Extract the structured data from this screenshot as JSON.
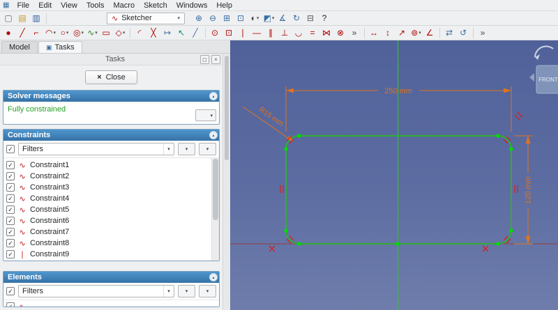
{
  "app": {
    "icon_glyph": "▦"
  },
  "menubar": {
    "items": [
      {
        "name": "menu-file",
        "label": "File"
      },
      {
        "name": "menu-edit",
        "label": "Edit"
      },
      {
        "name": "menu-view",
        "label": "View"
      },
      {
        "name": "menu-tools",
        "label": "Tools"
      },
      {
        "name": "menu-macro",
        "label": "Macro"
      },
      {
        "name": "menu-sketch",
        "label": "Sketch"
      },
      {
        "name": "menu-windows",
        "label": "Windows"
      },
      {
        "name": "menu-help",
        "label": "Help"
      }
    ]
  },
  "toolbar_file": {
    "icons": [
      {
        "name": "new-document-icon",
        "glyph": "▢",
        "color": "#6a6c6e",
        "cls": "tb-icon",
        "caret": "",
        "inter": "true"
      },
      {
        "name": "open-document-icon",
        "glyph": "▤",
        "color": "#c9972f",
        "cls": "tb-icon",
        "caret": "",
        "inter": "true"
      },
      {
        "name": "save-icon",
        "glyph": "▥",
        "color": "#2e5fa3",
        "cls": "tb-icon",
        "caret": "",
        "inter": "true"
      },
      {
        "name": "separator",
        "glyph": "",
        "color": "",
        "cls": "tb-sep",
        "caret": "",
        "inter": "false"
      }
    ]
  },
  "workbench": {
    "selected": "Sketcher",
    "icon": "∿",
    "caret": "▾"
  },
  "toolbar_view": {
    "icons": [
      {
        "name": "zoom-in-icon",
        "glyph": "⊕",
        "color": "#3a6ea5",
        "cls": "tb-icon",
        "caret": "",
        "inter": "true"
      },
      {
        "name": "zoom-out-icon",
        "glyph": "⊖",
        "color": "#3a6ea5",
        "cls": "tb-icon",
        "caret": "",
        "inter": "true"
      },
      {
        "name": "fit-all-icon",
        "glyph": "⊞",
        "color": "#3a6ea5",
        "cls": "tb-icon",
        "caret": "",
        "inter": "true"
      },
      {
        "name": "box-zoom-icon",
        "glyph": "⊡",
        "color": "#3a6ea5",
        "cls": "tb-icon",
        "caret": "",
        "inter": "true"
      },
      {
        "name": "draw-style-icon",
        "glyph": "◐",
        "color": "#3f4144",
        "cls": "tb-icon",
        "caret": "▾",
        "inter": "true"
      },
      {
        "name": "axonometric-view-icon",
        "glyph": "◩",
        "color": "#3a6ea5",
        "cls": "tb-icon",
        "caret": "▾",
        "inter": "true"
      },
      {
        "name": "measure-icon",
        "glyph": "∡",
        "color": "#3a6ea5",
        "cls": "tb-icon",
        "caret": "",
        "inter": "true"
      },
      {
        "name": "refresh-view-icon",
        "glyph": "↻",
        "color": "#3a6ea5",
        "cls": "tb-icon",
        "caret": "",
        "inter": "true"
      },
      {
        "name": "dock-view-icon",
        "glyph": "⊟",
        "color": "#55585b",
        "cls": "tb-icon",
        "caret": "",
        "inter": "true"
      },
      {
        "name": "help-whatsthis-icon",
        "glyph": "?",
        "color": "#232629",
        "cls": "tb-icon",
        "caret": "",
        "inter": "true"
      }
    ]
  },
  "toolbar_sketch": {
    "icons": [
      {
        "name": "create-point-icon",
        "glyph": "●",
        "color": "#b00000",
        "cls": "tb-icon",
        "caret": "",
        "inter": "true"
      },
      {
        "name": "create-line-icon",
        "glyph": "╱",
        "color": "#b00000",
        "cls": "tb-icon",
        "caret": "",
        "inter": "true"
      },
      {
        "name": "create-polyline-icon",
        "glyph": "⌐",
        "color": "#b00000",
        "cls": "tb-icon",
        "caret": "",
        "inter": "true"
      },
      {
        "name": "create-arc-icon",
        "glyph": "◠",
        "color": "#b00000",
        "cls": "tb-icon",
        "caret": "▾",
        "inter": "true"
      },
      {
        "name": "create-circle-icon",
        "glyph": "○",
        "color": "#b00000",
        "cls": "tb-icon",
        "caret": "▾",
        "inter": "true"
      },
      {
        "name": "create-conic-icon",
        "glyph": "◎",
        "color": "#b00000",
        "cls": "tb-icon",
        "caret": "▾",
        "inter": "true"
      },
      {
        "name": "create-bspline-icon",
        "glyph": "∿",
        "color": "#1e8a1e",
        "cls": "tb-icon",
        "caret": "▾",
        "inter": "true"
      },
      {
        "name": "create-rectangle-icon",
        "glyph": "▭",
        "color": "#b00000",
        "cls": "tb-icon",
        "caret": "",
        "inter": "true"
      },
      {
        "name": "create-polygon-icon",
        "glyph": "◇",
        "color": "#b00000",
        "cls": "tb-icon",
        "caret": "▾",
        "inter": "true"
      },
      {
        "name": "separator",
        "glyph": "",
        "color": "",
        "cls": "tb-sep",
        "caret": "",
        "inter": "false"
      },
      {
        "name": "create-fillet-icon",
        "glyph": "◜",
        "color": "#b00000",
        "cls": "tb-icon",
        "caret": "",
        "inter": "true"
      },
      {
        "name": "trim-edge-icon",
        "glyph": "╳",
        "color": "#b00000",
        "cls": "tb-icon",
        "caret": "",
        "inter": "true"
      },
      {
        "name": "extend-edge-icon",
        "glyph": "↦",
        "color": "#3a6ea5",
        "cls": "tb-icon",
        "caret": "",
        "inter": "true"
      },
      {
        "name": "external-geometry-icon",
        "glyph": "↖",
        "color": "#0a8a8a",
        "cls": "tb-icon",
        "caret": "",
        "inter": "true"
      },
      {
        "name": "toggle-construction-icon",
        "glyph": "╱",
        "color": "#3a6ea5",
        "cls": "tb-icon",
        "caret": "",
        "inter": "true"
      },
      {
        "name": "separator",
        "glyph": "",
        "color": "",
        "cls": "tb-sep",
        "caret": "",
        "inter": "false"
      },
      {
        "name": "constrain-coincident-icon",
        "glyph": "⊙",
        "color": "#b00000",
        "cls": "tb-icon",
        "caret": "",
        "inter": "true"
      },
      {
        "name": "constrain-point-on-object-icon",
        "glyph": "⊡",
        "color": "#b00000",
        "cls": "tb-icon",
        "caret": "",
        "inter": "true"
      },
      {
        "name": "constrain-vertical-icon",
        "glyph": "∣",
        "color": "#b00000",
        "cls": "tb-icon",
        "caret": "",
        "inter": "true"
      },
      {
        "name": "constrain-horizontal-icon",
        "glyph": "―",
        "color": "#b00000",
        "cls": "tb-icon",
        "caret": "",
        "inter": "true"
      },
      {
        "name": "constrain-parallel-icon",
        "glyph": "∥",
        "color": "#b00000",
        "cls": "tb-icon",
        "caret": "",
        "inter": "true"
      },
      {
        "name": "constrain-perpendicular-icon",
        "glyph": "⊥",
        "color": "#b00000",
        "cls": "tb-icon",
        "caret": "",
        "inter": "true"
      },
      {
        "name": "constrain-tangent-icon",
        "glyph": "◡",
        "color": "#b00000",
        "cls": "tb-icon",
        "caret": "",
        "inter": "true"
      },
      {
        "name": "constrain-equal-icon",
        "glyph": "=",
        "color": "#b00000",
        "cls": "tb-icon",
        "caret": "",
        "inter": "true"
      },
      {
        "name": "constrain-symmetric-icon",
        "glyph": "⋈",
        "color": "#b00000",
        "cls": "tb-icon",
        "caret": "",
        "inter": "true"
      },
      {
        "name": "constrain-block-icon",
        "glyph": "⊗",
        "color": "#b00000",
        "cls": "tb-icon",
        "caret": "",
        "inter": "true"
      },
      {
        "name": "constraints-overflow-icon",
        "glyph": "»",
        "color": "#444",
        "cls": "tb-icon",
        "caret": "",
        "inter": "true"
      },
      {
        "name": "separator",
        "glyph": "",
        "color": "",
        "cls": "tb-sep",
        "caret": "",
        "inter": "false"
      },
      {
        "name": "constrain-distance-x-icon",
        "glyph": "↔",
        "color": "#b00000",
        "cls": "tb-icon",
        "caret": "",
        "inter": "true"
      },
      {
        "name": "constrain-distance-y-icon",
        "glyph": "↕",
        "color": "#b00000",
        "cls": "tb-icon",
        "caret": "",
        "inter": "true"
      },
      {
        "name": "constrain-distance-icon",
        "glyph": "↗",
        "color": "#b00000",
        "cls": "tb-icon",
        "caret": "",
        "inter": "true"
      },
      {
        "name": "constrain-radius-icon",
        "glyph": "⊚",
        "color": "#b00000",
        "cls": "tb-icon",
        "caret": "▾",
        "inter": "true"
      },
      {
        "name": "constrain-angle-icon",
        "glyph": "∠",
        "color": "#b00000",
        "cls": "tb-icon",
        "caret": "",
        "inter": "true"
      },
      {
        "name": "separator",
        "glyph": "",
        "color": "",
        "cls": "tb-sep",
        "caret": "",
        "inter": "false"
      },
      {
        "name": "toggle-driving-constraint-icon",
        "glyph": "⇄",
        "color": "#3a6ea5",
        "cls": "tb-icon",
        "caret": "",
        "inter": "true"
      },
      {
        "name": "toggle-active-constraint-icon",
        "glyph": "↺",
        "color": "#3a6ea5",
        "cls": "tb-icon",
        "caret": "",
        "inter": "true"
      },
      {
        "name": "separator",
        "glyph": "",
        "color": "",
        "cls": "tb-sep",
        "caret": "",
        "inter": "false"
      },
      {
        "name": "toolbar-overflow-icon",
        "glyph": "»",
        "color": "#444",
        "cls": "tb-icon",
        "caret": "",
        "inter": "true"
      }
    ]
  },
  "ui": {
    "caret": "▾",
    "check": "✓",
    "collapse": "▴"
  },
  "panel": {
    "tabs": [
      {
        "label": "Model"
      },
      {
        "label": "Tasks",
        "icon": "▣"
      }
    ],
    "title": "Tasks",
    "win_buttons": {
      "float": "◻",
      "close": "×"
    },
    "close_icon": "×",
    "close_label": "Close",
    "solver": {
      "title": "Solver messages",
      "status": "Fully constrained",
      "status_color": "#22a022"
    },
    "constraints": {
      "title": "Constraints",
      "filters_label": "Filters",
      "items": [
        {
          "name": "constraint-row-1",
          "icon": "tangent-constraint-icon",
          "glyph": "∿",
          "color": "#c01616",
          "label": "Constraint1"
        },
        {
          "name": "constraint-row-2",
          "icon": "tangent-constraint-icon",
          "glyph": "∿",
          "color": "#c01616",
          "label": "Constraint2"
        },
        {
          "name": "constraint-row-3",
          "icon": "tangent-constraint-icon",
          "glyph": "∿",
          "color": "#c01616",
          "label": "Constraint3"
        },
        {
          "name": "constraint-row-4",
          "icon": "tangent-constraint-icon",
          "glyph": "∿",
          "color": "#c01616",
          "label": "Constraint4"
        },
        {
          "name": "constraint-row-5",
          "icon": "tangent-constraint-icon",
          "glyph": "∿",
          "color": "#c01616",
          "label": "Constraint5"
        },
        {
          "name": "constraint-row-6",
          "icon": "tangent-constraint-icon",
          "glyph": "∿",
          "color": "#c01616",
          "label": "Constraint6"
        },
        {
          "name": "constraint-row-7",
          "icon": "tangent-constraint-icon",
          "glyph": "∿",
          "color": "#c01616",
          "label": "Constraint7"
        },
        {
          "name": "constraint-row-8",
          "icon": "tangent-constraint-icon",
          "glyph": "∿",
          "color": "#c01616",
          "label": "Constraint8"
        },
        {
          "name": "constraint-row-9",
          "icon": "vertical-constraint-icon",
          "glyph": "∣",
          "color": "#c01616",
          "label": "Constraint9"
        }
      ]
    },
    "elements": {
      "title": "Elements",
      "filters_label": "Filters",
      "partial_item_glyph": "∿"
    }
  },
  "viewport": {
    "dimensions": {
      "width": "250 mm",
      "height": "120 mm",
      "radius": "R15 mm"
    },
    "nav_cube": {
      "front": "FRONT"
    },
    "colors": {
      "sketch_edge": "#2fae2f",
      "vertex": "#00dc00",
      "dimension": "#e2731c",
      "constraint_mark": "#d42020",
      "y_axis": "#2cc32c",
      "x_axis": "#a23434"
    }
  }
}
